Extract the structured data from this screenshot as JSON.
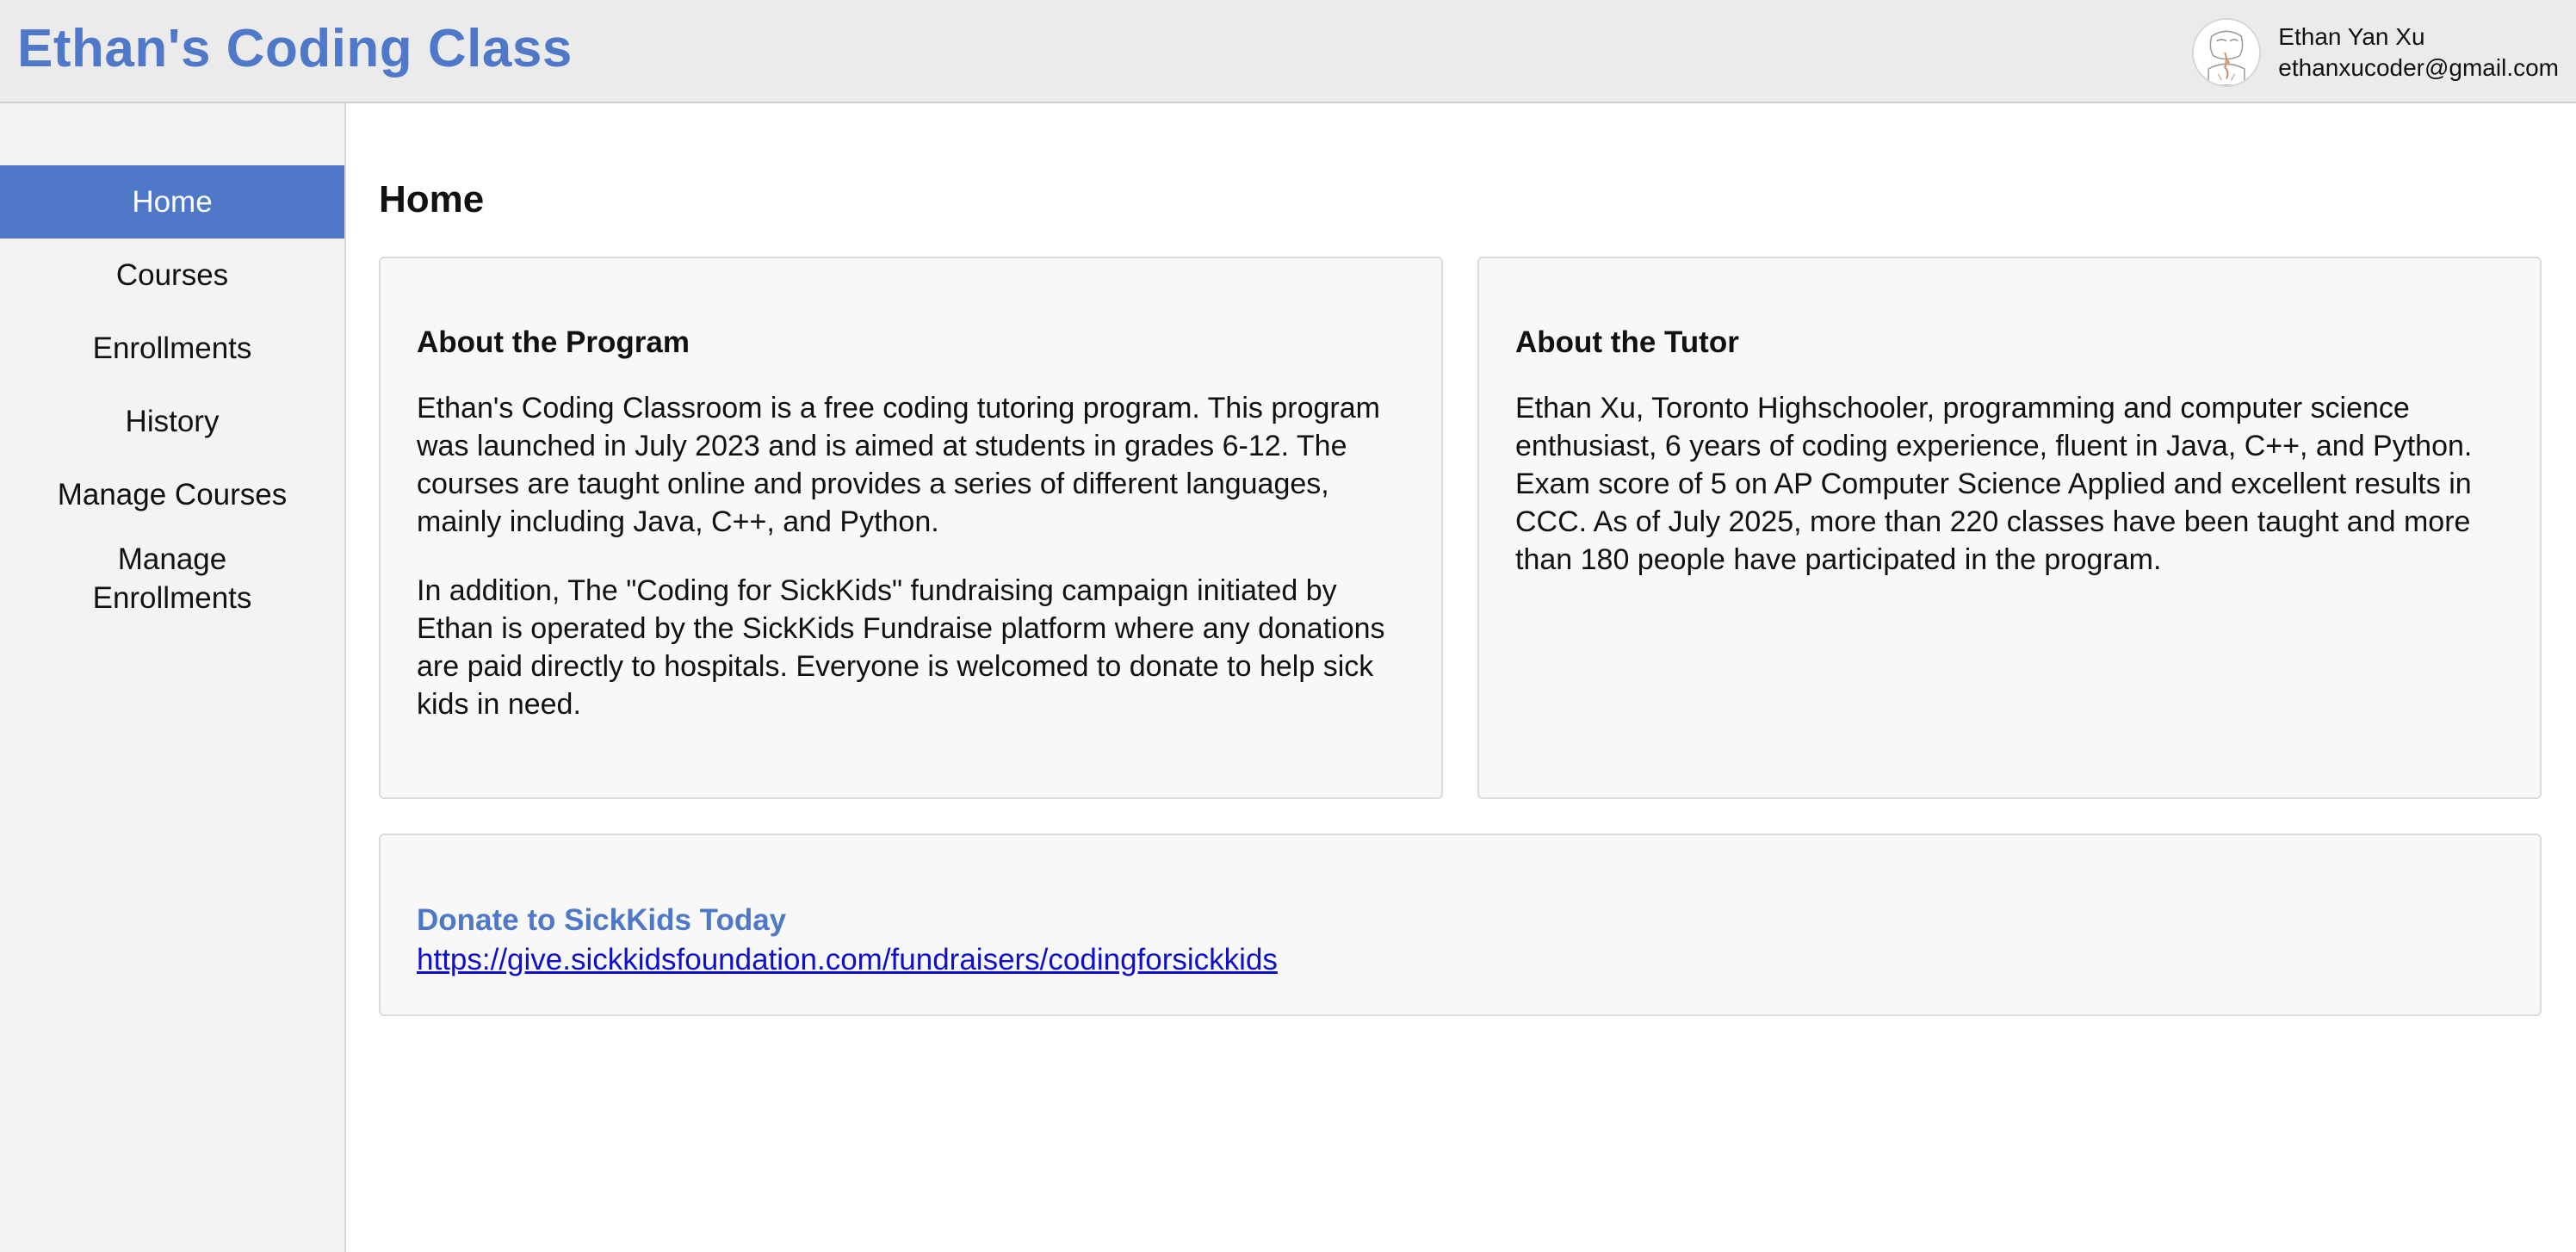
{
  "theme": {
    "accent": "#4f78c8",
    "link": "#1010cc",
    "header_bg": "#ebebeb",
    "sidebar_bg": "#f3f3f3",
    "card_bg": "#f8f8f8"
  },
  "header": {
    "title": "Ethan's Coding Class",
    "user": {
      "name": "Ethan Yan Xu",
      "email": "ethanxucoder@gmail.com",
      "avatar_icon": "user-avatar-icon"
    }
  },
  "sidebar": {
    "items": [
      {
        "label": "Home",
        "active": true
      },
      {
        "label": "Courses",
        "active": false
      },
      {
        "label": "Enrollments",
        "active": false
      },
      {
        "label": "History",
        "active": false
      },
      {
        "label": "Manage Courses",
        "active": false
      },
      {
        "label": "Manage Enrollments",
        "active": false
      }
    ]
  },
  "main": {
    "title": "Home",
    "program_card": {
      "heading": "About the Program",
      "paragraphs": [
        "Ethan's Coding Classroom is a free coding tutoring program. This program was launched in July 2023 and is aimed at students in grades 6-12. The courses are taught online and provides a series of different languages, mainly including Java, C++, and Python.",
        "In addition, The \"Coding for SickKids\" fundraising campaign initiated by Ethan is operated by the SickKids Fundraise platform where any donations are paid directly to hospitals. Everyone is welcomed to donate to help sick kids in need."
      ]
    },
    "tutor_card": {
      "heading": "About the Tutor",
      "paragraph": "Ethan Xu, Toronto Highschooler, programming and computer science enthusiast, 6 years of coding experience, fluent in Java, C++, and Python. Exam score of 5 on AP Computer Science Applied and excellent results in CCC. As of July 2025, more than 220 classes have been taught and more than 180 people have participated in the program."
    },
    "donate_card": {
      "heading": "Donate to SickKids Today",
      "link_text": "https://give.sickkidsfoundation.com/fundraisers/codingforsickkids"
    }
  }
}
